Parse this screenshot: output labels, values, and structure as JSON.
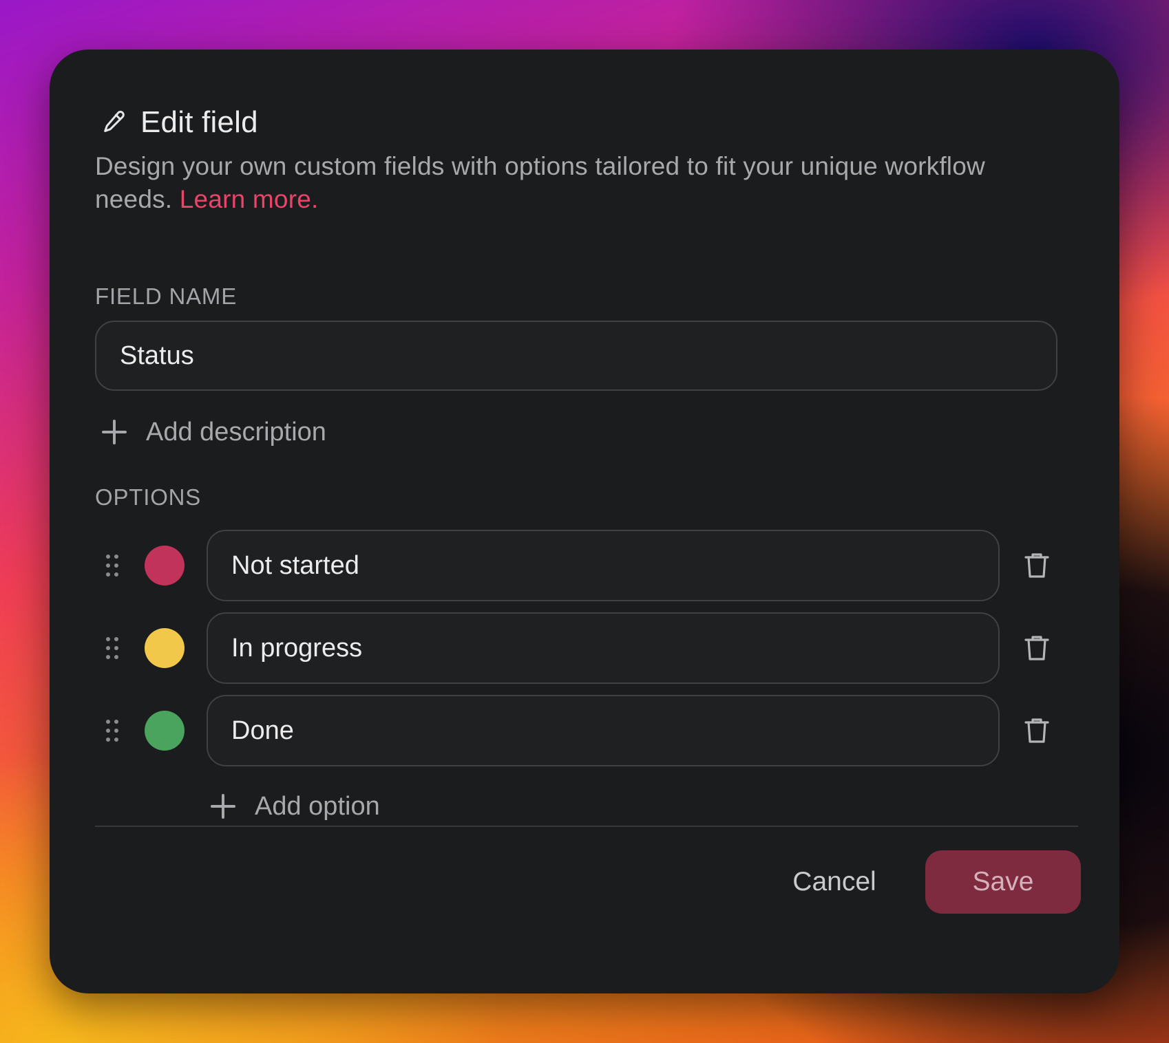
{
  "dialog": {
    "title": "Edit field",
    "description": "Design your own custom fields with options tailored to fit your unique workflow needs. ",
    "learn_more": "Learn more."
  },
  "field_name": {
    "label": "FIELD NAME",
    "value": "Status"
  },
  "add_description": {
    "label": "Add description"
  },
  "options": {
    "label": "OPTIONS",
    "items": [
      {
        "label": "Not started",
        "color": "#c1335a"
      },
      {
        "label": "In progress",
        "color": "#f2c84b"
      },
      {
        "label": "Done",
        "color": "#4aa45e"
      }
    ],
    "add_label": "Add option"
  },
  "footer": {
    "cancel_label": "Cancel",
    "save_label": "Save"
  },
  "colors": {
    "accent": "#e8456a",
    "save_button": "#7e2a3f"
  }
}
